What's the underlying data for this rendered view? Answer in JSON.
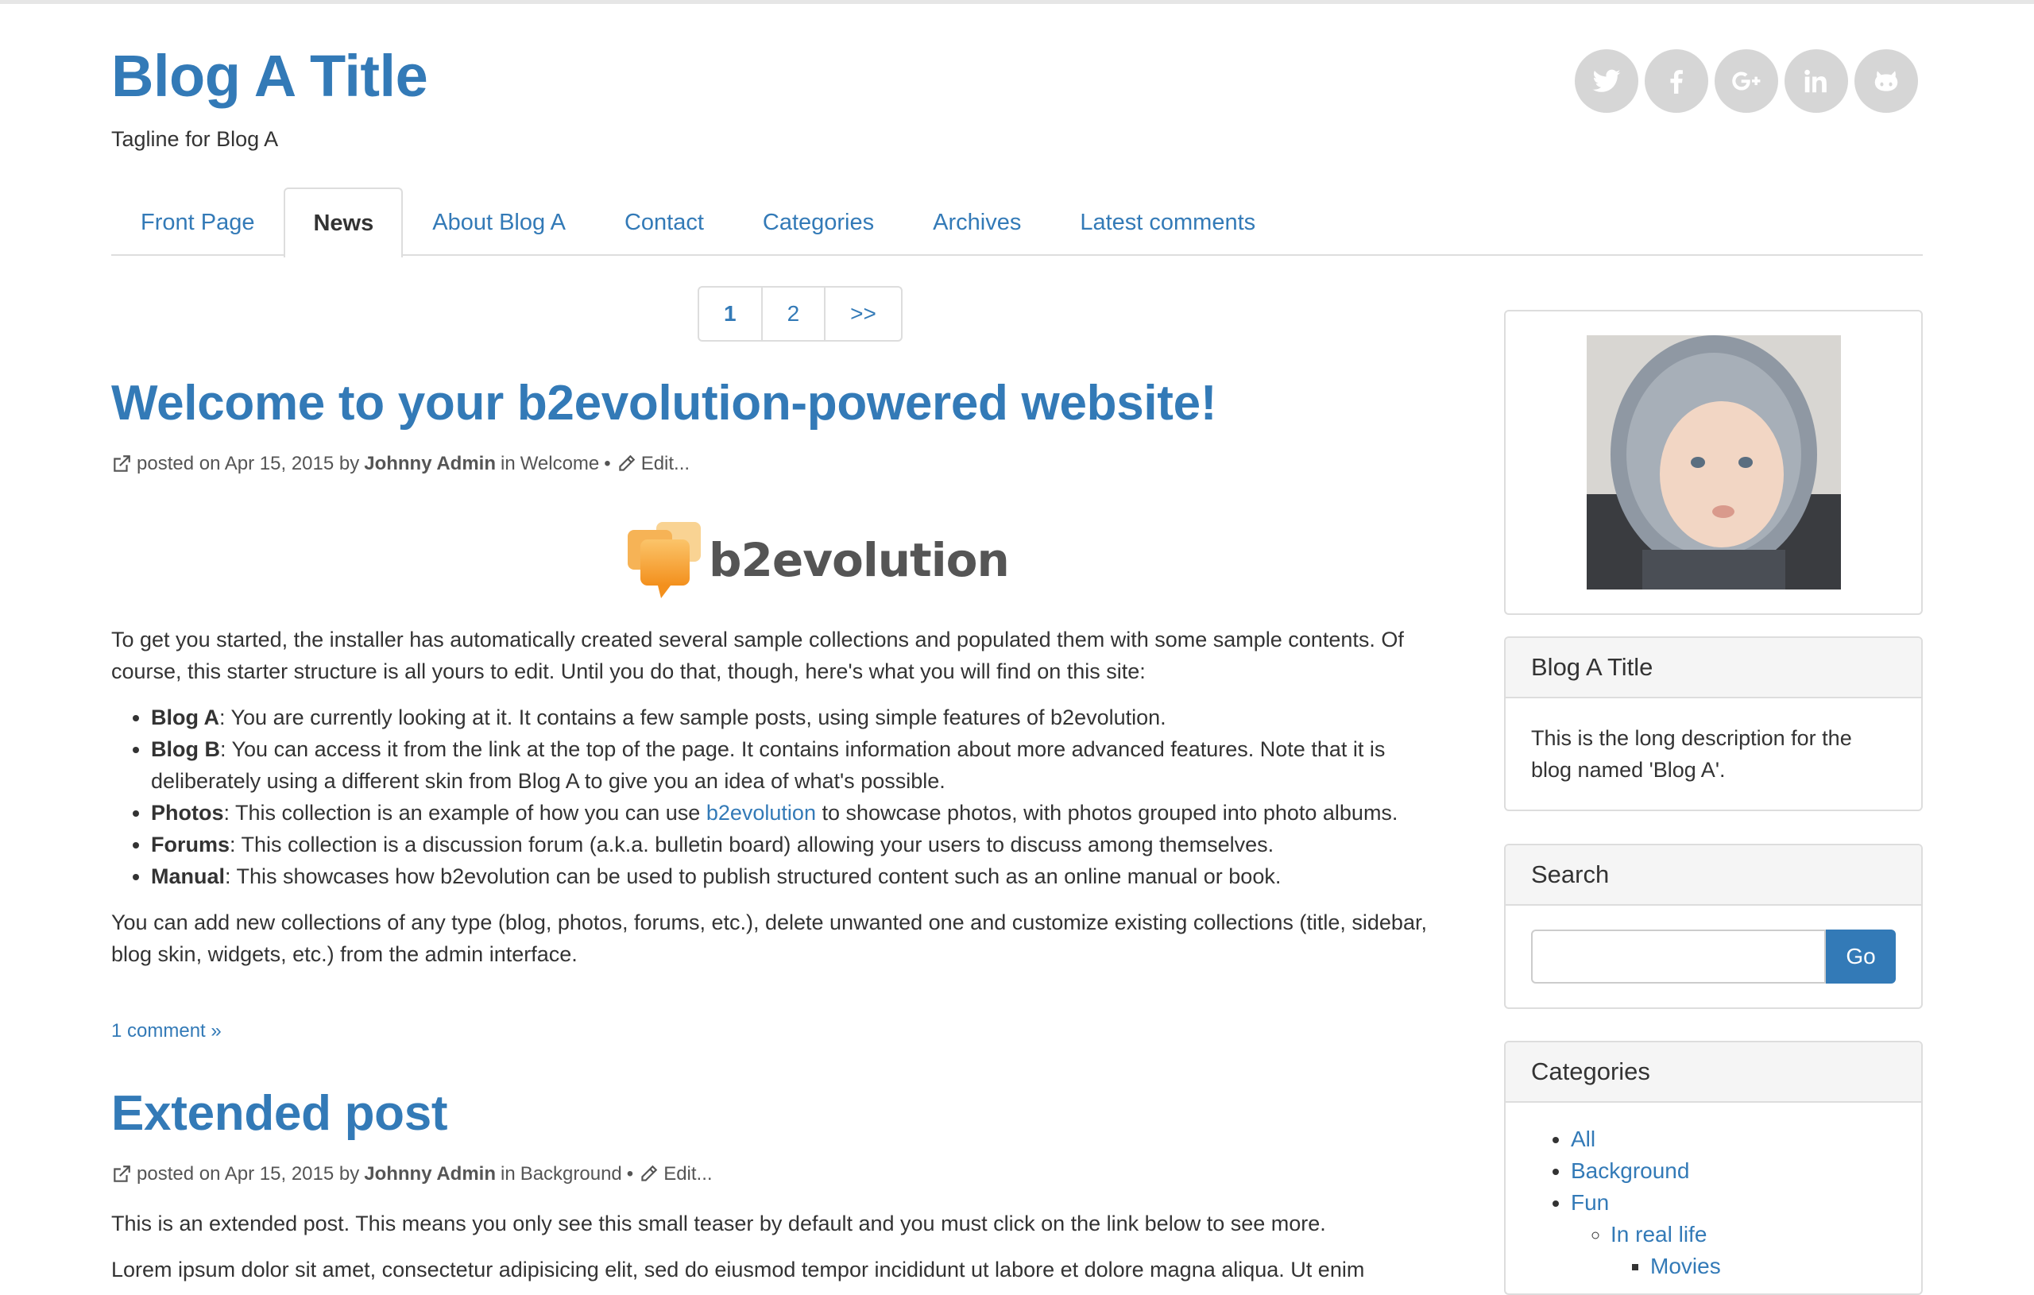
{
  "site": {
    "title": "Blog A Title",
    "tagline": "Tagline for Blog A",
    "accent_color": "#337ab7",
    "social": [
      {
        "icon": "twitter-icon"
      },
      {
        "icon": "facebook-icon"
      },
      {
        "icon": "google-plus-icon"
      },
      {
        "icon": "linkedin-icon"
      },
      {
        "icon": "github-icon"
      }
    ]
  },
  "nav": {
    "tabs": [
      {
        "label": "Front Page"
      },
      {
        "label": "News",
        "active": true
      },
      {
        "label": "About Blog A"
      },
      {
        "label": "Contact"
      },
      {
        "label": "Categories"
      },
      {
        "label": "Archives"
      },
      {
        "label": "Latest comments"
      }
    ]
  },
  "pagination": {
    "current": "1",
    "page2": "2",
    "next": ">>"
  },
  "posts": [
    {
      "title": "Welcome to your b2evolution-powered website!",
      "meta": {
        "posted_on": "posted on Apr 15, 2015 by",
        "author": "Johnny Admin",
        "in": "in",
        "category": "Welcome",
        "sep": "•",
        "edit": "Edit..."
      },
      "logo_text": "b2evolution",
      "intro": "To get you started, the installer has automatically created several sample collections and populated them with some sample contents. Of course, this starter structure is all yours to edit. Until you do that, though, here's what you will find on this site:",
      "bullets": [
        {
          "name": "Blog A",
          "text": ": You are currently looking at it. It contains a few sample posts, using simple features of b2evolution."
        },
        {
          "name": "Blog B",
          "text": ": You can access it from the link at the top of the page. It contains information about more advanced features. Note that it is deliberately using a different skin from Blog A to give you an idea of what's possible."
        },
        {
          "name": "Photos",
          "text_before": ": This collection is an example of how you can use ",
          "link": "b2evolution",
          "text_after": " to showcase photos, with photos grouped into photo albums."
        },
        {
          "name": "Forums",
          "text": ": This collection is a discussion forum (a.k.a. bulletin board) allowing your users to discuss among themselves."
        },
        {
          "name": "Manual",
          "text": ": This showcases how b2evolution can be used to publish structured content such as an online manual or book."
        }
      ],
      "outro": "You can add new collections of any type (blog, photos, forums, etc.), delete unwanted one and customize existing collections (title, sidebar, blog skin, widgets, etc.) from the admin interface.",
      "comments_link": "1 comment »"
    },
    {
      "title": "Extended post",
      "meta": {
        "posted_on": "posted on Apr 15, 2015 by",
        "author": "Johnny Admin",
        "in": "in",
        "category": "Background",
        "sep": "•",
        "edit": "Edit..."
      },
      "teaser": "This is an extended post. This means you only see this small teaser by default and you must click on the link below to see more.",
      "lorem": "Lorem ipsum dolor sit amet, consectetur adipisicing elit, sed do eiusmod tempor incididunt ut labore et dolore magna aliqua. Ut enim"
    }
  ],
  "sidebar": {
    "about": {
      "title": "Blog A Title",
      "description": "This is the long description for the blog named 'Blog A'."
    },
    "search": {
      "title": "Search",
      "button": "Go",
      "value": ""
    },
    "categories": {
      "title": "Categories",
      "items": [
        "All",
        "Background",
        "Fun"
      ],
      "sub_items": [
        "In real life"
      ],
      "sub_sub_items": [
        "Movies"
      ]
    }
  }
}
